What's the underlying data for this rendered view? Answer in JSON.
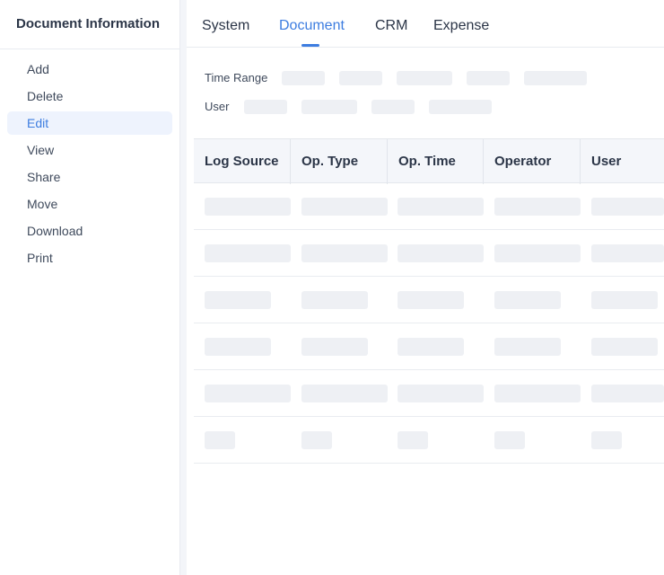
{
  "sidebar": {
    "title": "Document Information",
    "items": [
      {
        "label": "Add"
      },
      {
        "label": "Delete"
      },
      {
        "label": "Edit",
        "active": true
      },
      {
        "label": "View"
      },
      {
        "label": "Share"
      },
      {
        "label": "Move"
      },
      {
        "label": "Download"
      },
      {
        "label": "Print"
      }
    ]
  },
  "tabs": [
    {
      "label": "System"
    },
    {
      "label": "Document",
      "active": true
    },
    {
      "label": "CRM"
    },
    {
      "label": "Expense"
    }
  ],
  "filters": {
    "time_range_label": "Time Range",
    "user_label": "User"
  },
  "table": {
    "columns": [
      "Log Source",
      "Op. Type",
      "Op. Time",
      "Operator",
      "User"
    ]
  },
  "colors": {
    "accent": "#3d7de0",
    "skeleton": "#eef0f4",
    "active_bg": "#eef3fd"
  }
}
